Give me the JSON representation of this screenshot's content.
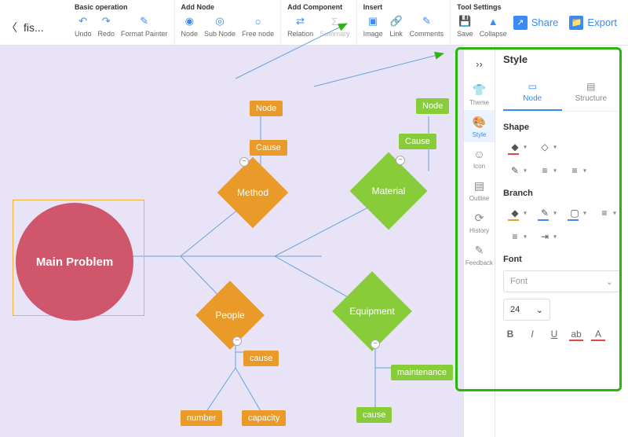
{
  "file_name": "fis...",
  "toolbar_groups": {
    "basic": {
      "title": "Basic operation",
      "undo": "Undo",
      "redo": "Redo",
      "format_painter": "Format Painter"
    },
    "add_node": {
      "title": "Add Node",
      "node": "Node",
      "sub_node": "Sub Node",
      "free_node": "Free node"
    },
    "add_component": {
      "title": "Add Component",
      "relation": "Relation",
      "summary": "Summary"
    },
    "insert": {
      "title": "Insert",
      "image": "Image",
      "link": "Link",
      "comments": "Comments"
    },
    "tool_settings": {
      "title": "Tool Settings",
      "save": "Save",
      "collapse": "Collapse"
    }
  },
  "top_right": {
    "share": "Share",
    "export": "Export"
  },
  "tool_strip": {
    "theme": "Theme",
    "style": "Style",
    "icon": "Icon",
    "outline": "Outline",
    "history": "History",
    "feedback": "Feedback"
  },
  "style_panel": {
    "title": "Style",
    "tab_node": "Node",
    "tab_structure": "Structure",
    "shape_title": "Shape",
    "branch_title": "Branch",
    "font_title": "Font",
    "font_placeholder": "Font",
    "font_size_value": "24",
    "bold": "B",
    "italic": "I",
    "underline": "U",
    "ab": "ab",
    "font_color": "A"
  },
  "diagram": {
    "main": "Main Problem",
    "branches": {
      "method": {
        "label": "Method",
        "node": "Node",
        "cause": "Cause"
      },
      "material": {
        "label": "Material",
        "node": "Node",
        "cause": "Cause"
      },
      "people": {
        "label": "People",
        "cause": "cause",
        "number": "number",
        "capacity": "capacity"
      },
      "equipment": {
        "label": "Equipment",
        "maintenance": "maintenance",
        "cause": "cause"
      }
    }
  }
}
